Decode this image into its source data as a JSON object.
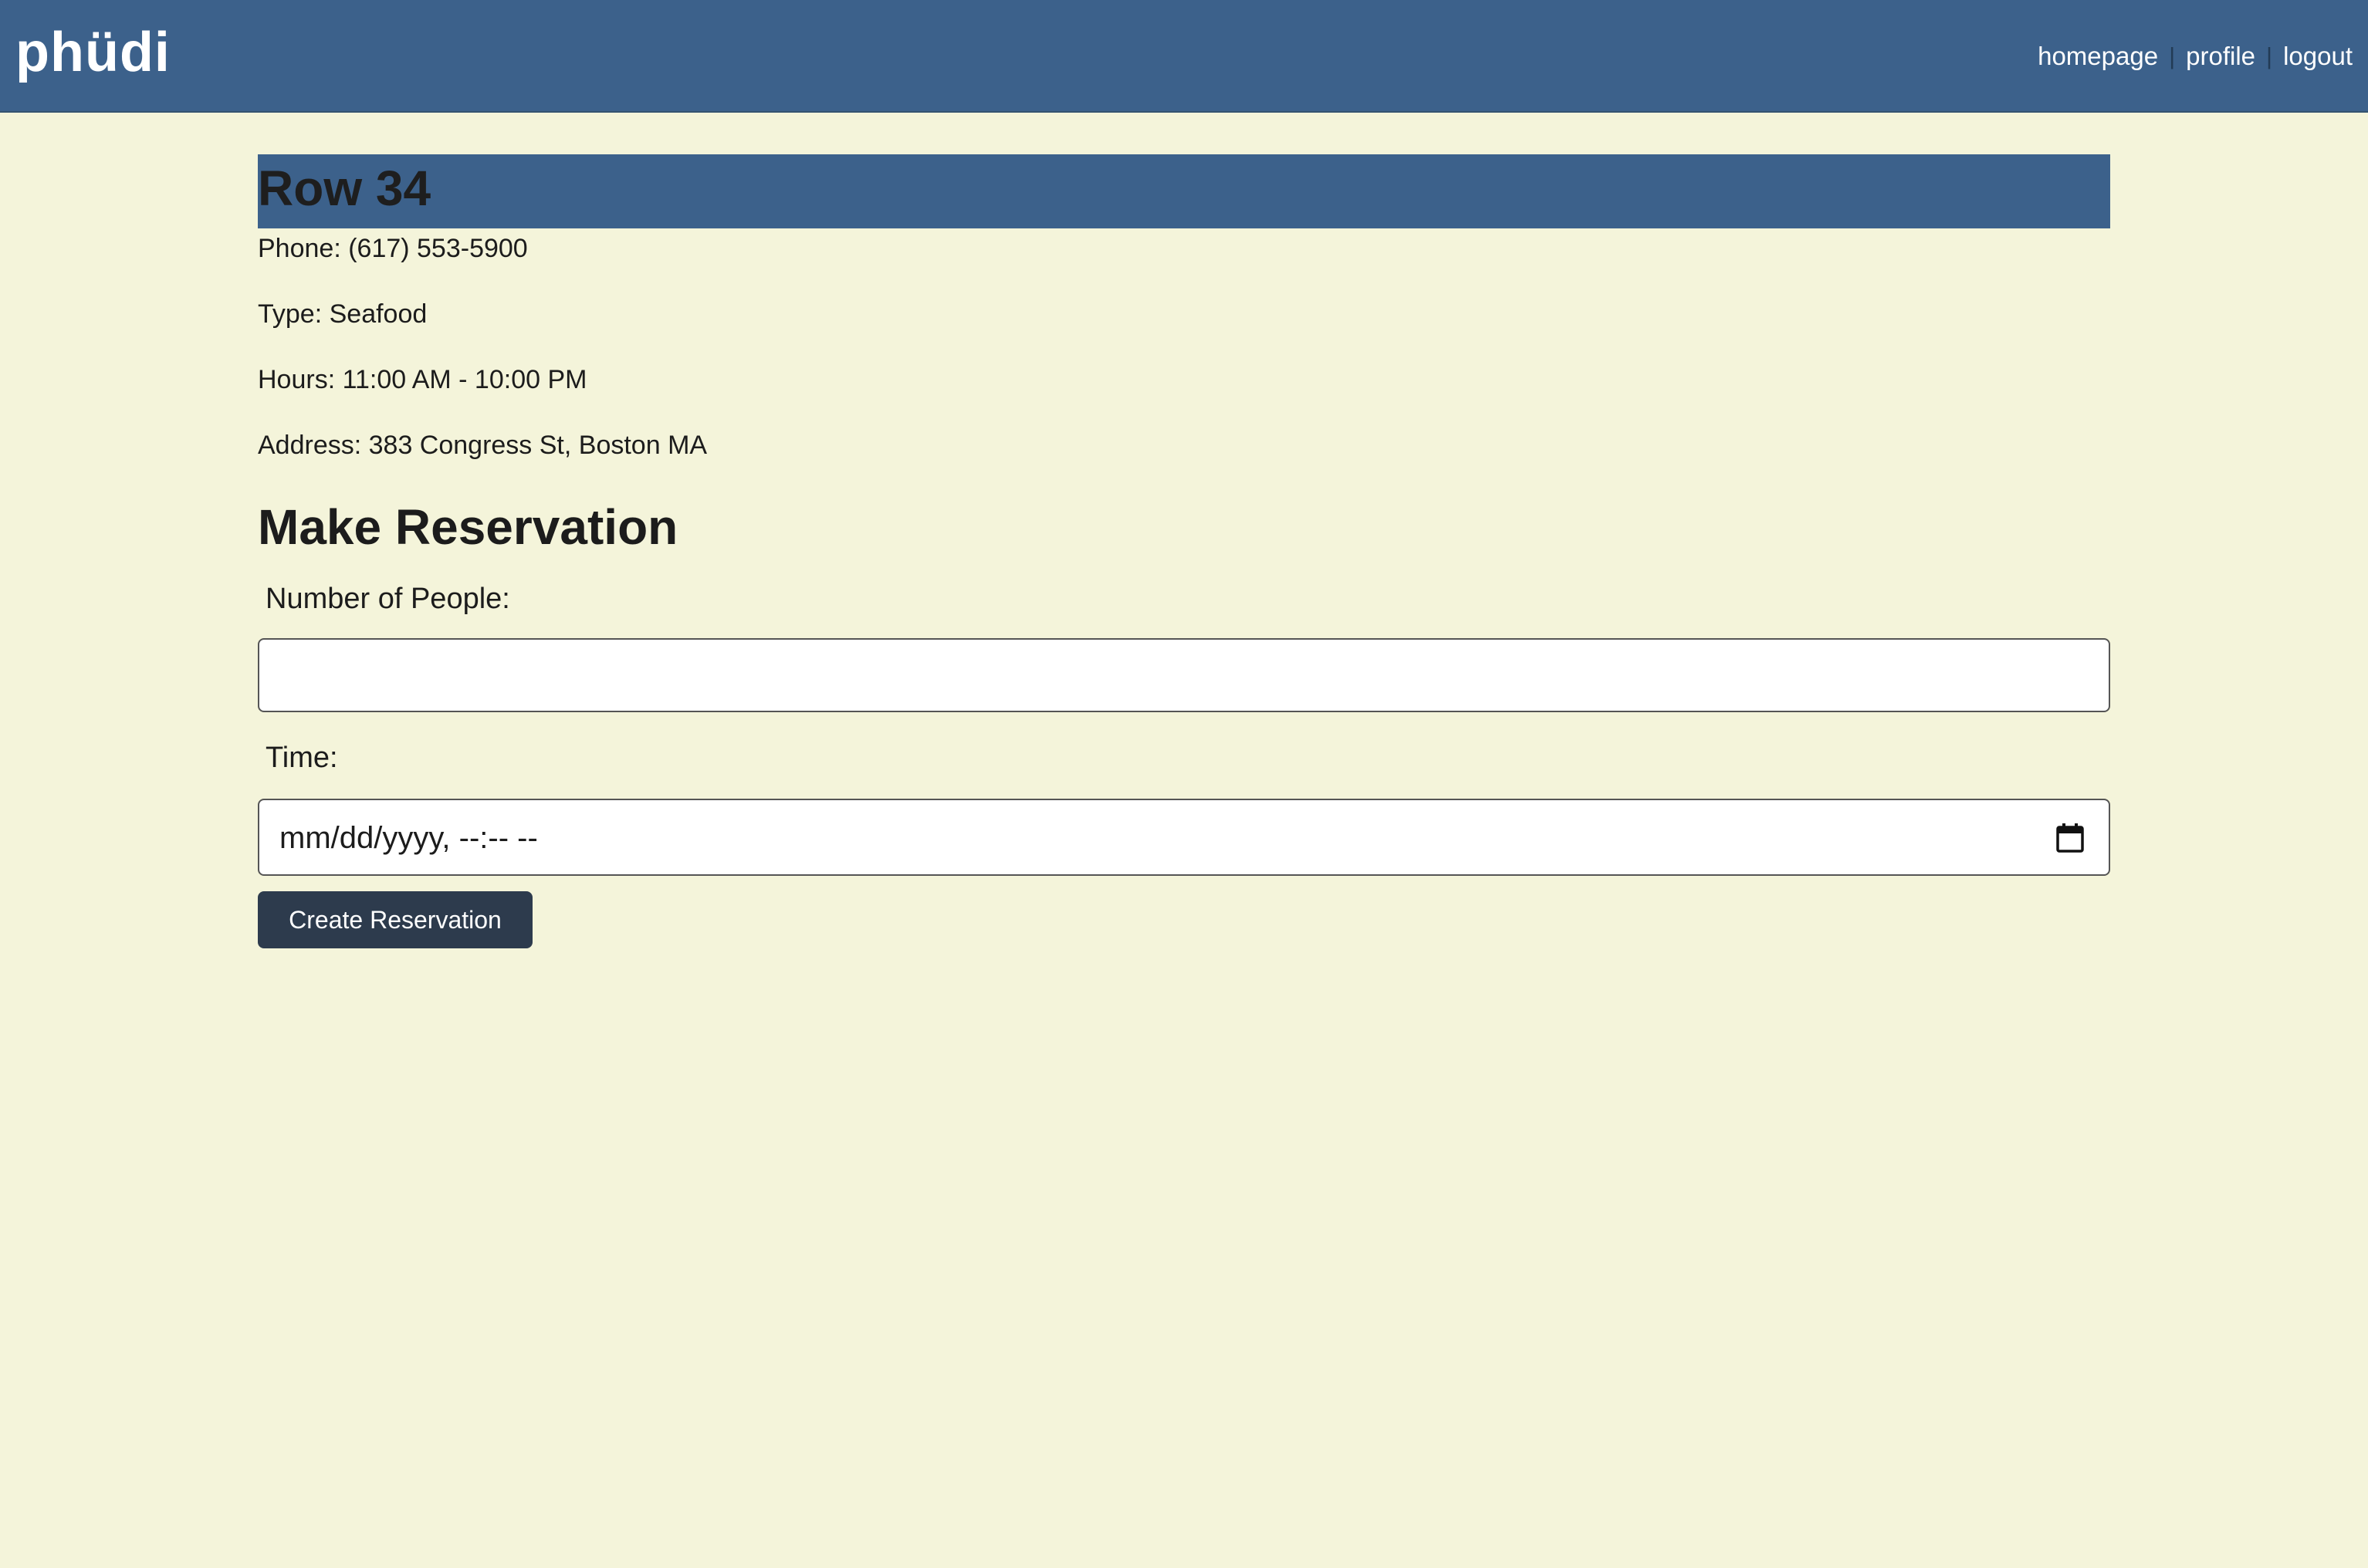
{
  "header": {
    "logo": "phüdi",
    "nav": {
      "homepage": "homepage",
      "profile": "profile",
      "logout": "logout",
      "separator": "|"
    }
  },
  "restaurant": {
    "name": "Row 34",
    "phone": "Phone: (617) 553-5900",
    "type": "Type: Seafood",
    "hours": "Hours: 11:00 AM - 10:00 PM",
    "address": "Address: 383 Congress St, Boston MA"
  },
  "reservation": {
    "title": "Make Reservation",
    "people_label": "Number of People:",
    "people_value": "",
    "time_label": "Time:",
    "time_placeholder": "mm/dd/yyyy, --:-- --",
    "submit_label": "Create Reservation",
    "calendar_icon": "calendar-icon"
  },
  "colors": {
    "header_bg": "#3c618b",
    "page_bg": "#f4f4da",
    "button_bg": "#2d3b4d"
  }
}
